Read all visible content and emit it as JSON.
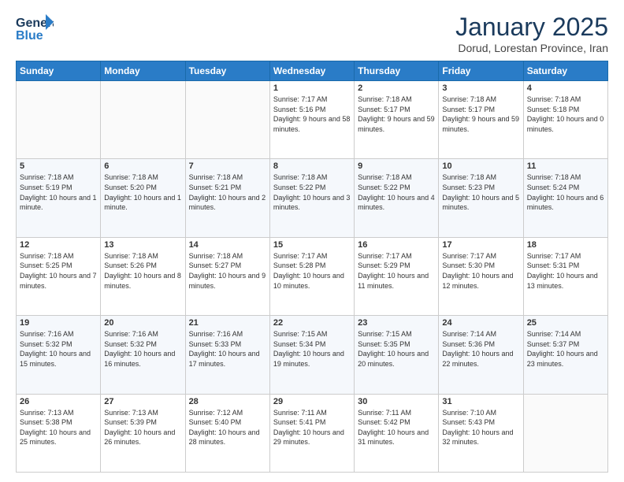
{
  "header": {
    "logo_line1": "General",
    "logo_line2": "Blue",
    "month_title": "January 2025",
    "subtitle": "Dorud, Lorestan Province, Iran"
  },
  "days_of_week": [
    "Sunday",
    "Monday",
    "Tuesday",
    "Wednesday",
    "Thursday",
    "Friday",
    "Saturday"
  ],
  "weeks": [
    [
      {
        "num": "",
        "sunrise": "",
        "sunset": "",
        "daylight": ""
      },
      {
        "num": "",
        "sunrise": "",
        "sunset": "",
        "daylight": ""
      },
      {
        "num": "",
        "sunrise": "",
        "sunset": "",
        "daylight": ""
      },
      {
        "num": "1",
        "sunrise": "Sunrise: 7:17 AM",
        "sunset": "Sunset: 5:16 PM",
        "daylight": "Daylight: 9 hours and 58 minutes."
      },
      {
        "num": "2",
        "sunrise": "Sunrise: 7:18 AM",
        "sunset": "Sunset: 5:17 PM",
        "daylight": "Daylight: 9 hours and 59 minutes."
      },
      {
        "num": "3",
        "sunrise": "Sunrise: 7:18 AM",
        "sunset": "Sunset: 5:17 PM",
        "daylight": "Daylight: 9 hours and 59 minutes."
      },
      {
        "num": "4",
        "sunrise": "Sunrise: 7:18 AM",
        "sunset": "Sunset: 5:18 PM",
        "daylight": "Daylight: 10 hours and 0 minutes."
      }
    ],
    [
      {
        "num": "5",
        "sunrise": "Sunrise: 7:18 AM",
        "sunset": "Sunset: 5:19 PM",
        "daylight": "Daylight: 10 hours and 1 minute."
      },
      {
        "num": "6",
        "sunrise": "Sunrise: 7:18 AM",
        "sunset": "Sunset: 5:20 PM",
        "daylight": "Daylight: 10 hours and 1 minute."
      },
      {
        "num": "7",
        "sunrise": "Sunrise: 7:18 AM",
        "sunset": "Sunset: 5:21 PM",
        "daylight": "Daylight: 10 hours and 2 minutes."
      },
      {
        "num": "8",
        "sunrise": "Sunrise: 7:18 AM",
        "sunset": "Sunset: 5:22 PM",
        "daylight": "Daylight: 10 hours and 3 minutes."
      },
      {
        "num": "9",
        "sunrise": "Sunrise: 7:18 AM",
        "sunset": "Sunset: 5:22 PM",
        "daylight": "Daylight: 10 hours and 4 minutes."
      },
      {
        "num": "10",
        "sunrise": "Sunrise: 7:18 AM",
        "sunset": "Sunset: 5:23 PM",
        "daylight": "Daylight: 10 hours and 5 minutes."
      },
      {
        "num": "11",
        "sunrise": "Sunrise: 7:18 AM",
        "sunset": "Sunset: 5:24 PM",
        "daylight": "Daylight: 10 hours and 6 minutes."
      }
    ],
    [
      {
        "num": "12",
        "sunrise": "Sunrise: 7:18 AM",
        "sunset": "Sunset: 5:25 PM",
        "daylight": "Daylight: 10 hours and 7 minutes."
      },
      {
        "num": "13",
        "sunrise": "Sunrise: 7:18 AM",
        "sunset": "Sunset: 5:26 PM",
        "daylight": "Daylight: 10 hours and 8 minutes."
      },
      {
        "num": "14",
        "sunrise": "Sunrise: 7:18 AM",
        "sunset": "Sunset: 5:27 PM",
        "daylight": "Daylight: 10 hours and 9 minutes."
      },
      {
        "num": "15",
        "sunrise": "Sunrise: 7:17 AM",
        "sunset": "Sunset: 5:28 PM",
        "daylight": "Daylight: 10 hours and 10 minutes."
      },
      {
        "num": "16",
        "sunrise": "Sunrise: 7:17 AM",
        "sunset": "Sunset: 5:29 PM",
        "daylight": "Daylight: 10 hours and 11 minutes."
      },
      {
        "num": "17",
        "sunrise": "Sunrise: 7:17 AM",
        "sunset": "Sunset: 5:30 PM",
        "daylight": "Daylight: 10 hours and 12 minutes."
      },
      {
        "num": "18",
        "sunrise": "Sunrise: 7:17 AM",
        "sunset": "Sunset: 5:31 PM",
        "daylight": "Daylight: 10 hours and 13 minutes."
      }
    ],
    [
      {
        "num": "19",
        "sunrise": "Sunrise: 7:16 AM",
        "sunset": "Sunset: 5:32 PM",
        "daylight": "Daylight: 10 hours and 15 minutes."
      },
      {
        "num": "20",
        "sunrise": "Sunrise: 7:16 AM",
        "sunset": "Sunset: 5:32 PM",
        "daylight": "Daylight: 10 hours and 16 minutes."
      },
      {
        "num": "21",
        "sunrise": "Sunrise: 7:16 AM",
        "sunset": "Sunset: 5:33 PM",
        "daylight": "Daylight: 10 hours and 17 minutes."
      },
      {
        "num": "22",
        "sunrise": "Sunrise: 7:15 AM",
        "sunset": "Sunset: 5:34 PM",
        "daylight": "Daylight: 10 hours and 19 minutes."
      },
      {
        "num": "23",
        "sunrise": "Sunrise: 7:15 AM",
        "sunset": "Sunset: 5:35 PM",
        "daylight": "Daylight: 10 hours and 20 minutes."
      },
      {
        "num": "24",
        "sunrise": "Sunrise: 7:14 AM",
        "sunset": "Sunset: 5:36 PM",
        "daylight": "Daylight: 10 hours and 22 minutes."
      },
      {
        "num": "25",
        "sunrise": "Sunrise: 7:14 AM",
        "sunset": "Sunset: 5:37 PM",
        "daylight": "Daylight: 10 hours and 23 minutes."
      }
    ],
    [
      {
        "num": "26",
        "sunrise": "Sunrise: 7:13 AM",
        "sunset": "Sunset: 5:38 PM",
        "daylight": "Daylight: 10 hours and 25 minutes."
      },
      {
        "num": "27",
        "sunrise": "Sunrise: 7:13 AM",
        "sunset": "Sunset: 5:39 PM",
        "daylight": "Daylight: 10 hours and 26 minutes."
      },
      {
        "num": "28",
        "sunrise": "Sunrise: 7:12 AM",
        "sunset": "Sunset: 5:40 PM",
        "daylight": "Daylight: 10 hours and 28 minutes."
      },
      {
        "num": "29",
        "sunrise": "Sunrise: 7:11 AM",
        "sunset": "Sunset: 5:41 PM",
        "daylight": "Daylight: 10 hours and 29 minutes."
      },
      {
        "num": "30",
        "sunrise": "Sunrise: 7:11 AM",
        "sunset": "Sunset: 5:42 PM",
        "daylight": "Daylight: 10 hours and 31 minutes."
      },
      {
        "num": "31",
        "sunrise": "Sunrise: 7:10 AM",
        "sunset": "Sunset: 5:43 PM",
        "daylight": "Daylight: 10 hours and 32 minutes."
      },
      {
        "num": "",
        "sunrise": "",
        "sunset": "",
        "daylight": ""
      }
    ]
  ]
}
